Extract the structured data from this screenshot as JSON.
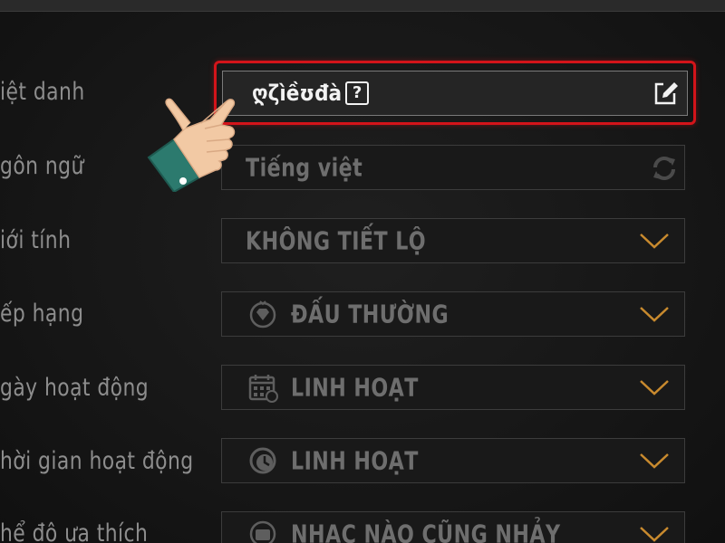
{
  "profile": {
    "nickname_label": "iệt danh",
    "nickname_value": "ღζìềʊđà",
    "nickname_box_char": "?",
    "language_label": "gôn ngữ",
    "language_value": "Tiếng việt",
    "gender_label": "iới tính",
    "gender_value": "KHÔNG TIẾT LỘ",
    "rank_label": "ếp hạng",
    "rank_value": "ĐẤU THƯỜNG",
    "activedays_label": "gày hoạt động",
    "activedays_value": "LINH HOẠT",
    "activetime_label": "hời gian hoạt động",
    "activetime_value": "LINH HOẠT",
    "music_label": "hể độ ưa thích",
    "music_value": "NHẠC NÀO CŨNG NHẢY"
  },
  "colors": {
    "highlight": "#d3141a",
    "chevron": "#c88a2e",
    "label": "#8d8d8d",
    "value": "#6e6e6e"
  },
  "icons": {
    "edit": "pencil-edit-icon",
    "refresh": "refresh-icon",
    "dropdown": "chevron-down-icon",
    "rank": "rank-diamond-icon",
    "calendar": "calendar-icon",
    "clock": "clock-icon",
    "music": "music-icon",
    "pointer": "pointing-hand-icon"
  }
}
